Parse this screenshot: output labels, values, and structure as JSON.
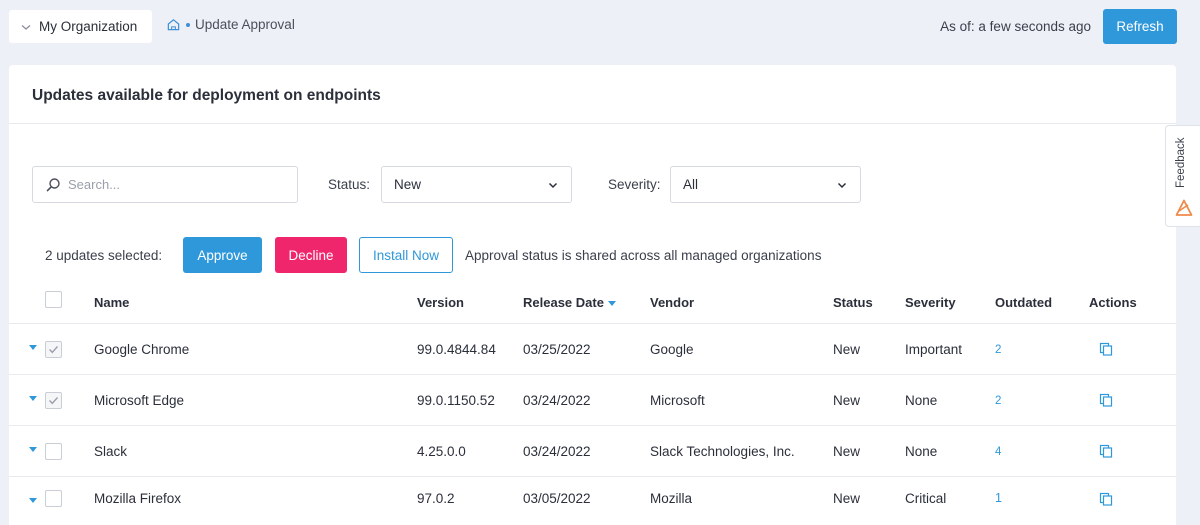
{
  "topbar": {
    "org_selector": "My Organization",
    "breadcrumb": "Update Approval",
    "as_of": "As of: a few seconds ago",
    "refresh_label": "Refresh"
  },
  "card": {
    "title": "Updates available for deployment on endpoints"
  },
  "filters": {
    "search_placeholder": "Search...",
    "status_label": "Status:",
    "status_value": "New",
    "severity_label": "Severity:",
    "severity_value": "All"
  },
  "bulk": {
    "selected_text": "2 updates selected:",
    "approve_label": "Approve",
    "decline_label": "Decline",
    "install_label": "Install Now",
    "note": "Approval status is shared across all managed organizations"
  },
  "table": {
    "columns": {
      "name": "Name",
      "version": "Version",
      "release_date": "Release Date",
      "vendor": "Vendor",
      "status": "Status",
      "severity": "Severity",
      "outdated": "Outdated",
      "actions": "Actions"
    },
    "rows": [
      {
        "name": "Google Chrome",
        "version": "99.0.4844.84",
        "release_date": "03/25/2022",
        "vendor": "Google",
        "status": "New",
        "severity": "Important",
        "outdated": "2",
        "checked": true
      },
      {
        "name": "Microsoft Edge",
        "version": "99.0.1150.52",
        "release_date": "03/24/2022",
        "vendor": "Microsoft",
        "status": "New",
        "severity": "None",
        "outdated": "2",
        "checked": true
      },
      {
        "name": "Slack",
        "version": "4.25.0.0",
        "release_date": "03/24/2022",
        "vendor": "Slack Technologies, Inc.",
        "status": "New",
        "severity": "None",
        "outdated": "4",
        "checked": false
      },
      {
        "name": "Mozilla Firefox",
        "version": "97.0.2",
        "release_date": "03/05/2022",
        "vendor": "Mozilla",
        "status": "New",
        "severity": "Critical",
        "outdated": "1",
        "checked": false
      }
    ]
  },
  "feedback": {
    "label": "Feedback"
  },
  "colors": {
    "accent": "#2f98da",
    "decline": "#f0266d",
    "background": "#eef0f7"
  }
}
